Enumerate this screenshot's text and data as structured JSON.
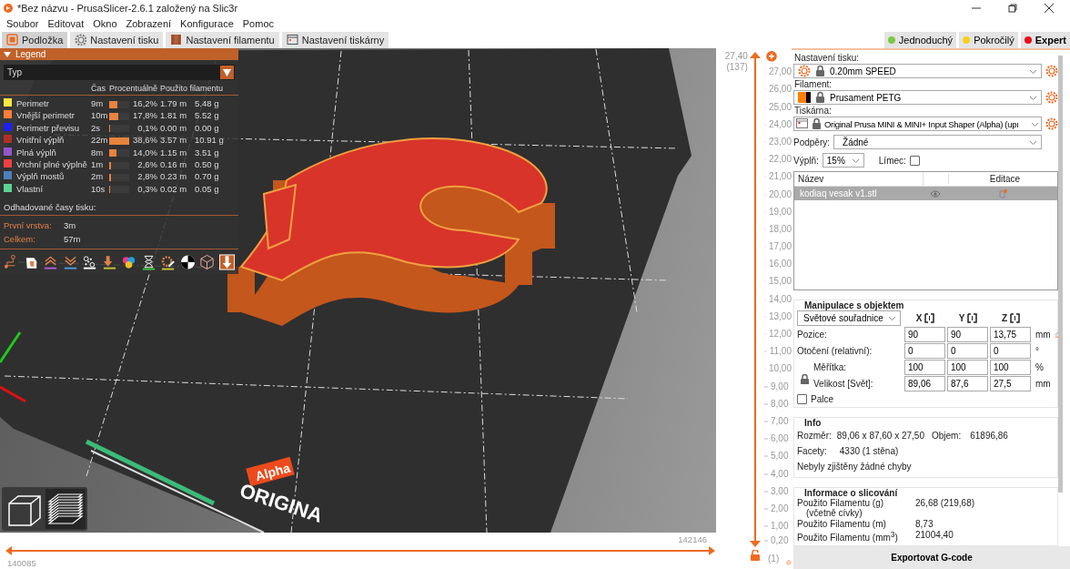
{
  "window": {
    "title": "*Bez názvu - PrusaSlicer-2.6.1 založený na Slic3r"
  },
  "menu": [
    "Soubor",
    "Editovat",
    "Okno",
    "Zobrazení",
    "Konfigurace",
    "Pomoc"
  ],
  "tabs": [
    {
      "label": "Podložka",
      "kind": "plater",
      "selected": true
    },
    {
      "label": "Nastavení tisku",
      "kind": "print",
      "selected": false
    },
    {
      "label": "Nastavení filamentu",
      "kind": "filament",
      "selected": false
    },
    {
      "label": "Nastavení tiskárny",
      "kind": "printer",
      "selected": false
    }
  ],
  "modes": [
    {
      "label": "Jednoduchý",
      "color": "#7ac943",
      "selected": false
    },
    {
      "label": "Pokročilý",
      "color": "#f2d21c",
      "selected": false
    },
    {
      "label": "Expert",
      "color": "#e8101a",
      "selected": true
    }
  ],
  "legend": {
    "title": "Legend",
    "expanded": true,
    "view_type": "Typ",
    "columns": [
      "Čas",
      "Procentuálně",
      "Použito filamentu"
    ],
    "rows": [
      {
        "name": "Perimetr",
        "color": "#ffe640",
        "time": "9m",
        "level": 0.42,
        "percent": "16,2%",
        "length": "1.79 m",
        "weight": "5.48 g"
      },
      {
        "name": "Vnější perimetr",
        "color": "#ff7d38",
        "time": "10m",
        "level": 0.46,
        "percent": "17,8%",
        "length": "1.81 m",
        "weight": "5.52 g"
      },
      {
        "name": "Perimetr převisu",
        "color": "#1f1fff",
        "time": "2s",
        "level": 0.01,
        "percent": "0,1%",
        "length": "0.00 m",
        "weight": "0.00 g"
      },
      {
        "name": "Vnitřní výplň",
        "color": "#b03029",
        "time": "22m",
        "level": 1,
        "percent": "38,6%",
        "length": "3.57 m",
        "weight": "10.91 g"
      },
      {
        "name": "Plná výplň",
        "color": "#9654cc",
        "time": "8m",
        "level": 0.36,
        "percent": "14,0%",
        "length": "1.15 m",
        "weight": "3.51 g"
      },
      {
        "name": "Vrchní plné výplně",
        "color": "#f04040",
        "time": "1m",
        "level": 0.07,
        "percent": "2,6%",
        "length": "0.16 m",
        "weight": "0.50 g"
      },
      {
        "name": "Výplň mostů",
        "color": "#4d80ba",
        "time": "2m",
        "level": 0.07,
        "percent": "2,8%",
        "length": "0.23 m",
        "weight": "0.70 g"
      },
      {
        "name": "Vlastní",
        "color": "#5ed194",
        "time": "10s",
        "level": 0.01,
        "percent": "0,3%",
        "length": "0.02 m",
        "weight": "0.05 g"
      }
    ],
    "estimates_title": "Odhadované časy tisku:",
    "estimates": [
      {
        "label": "První vrstva:",
        "value": "3m"
      },
      {
        "label": "Celkem:",
        "value": "57m"
      }
    ]
  },
  "bed_marks": [
    "Alpha",
    "ORIGINA"
  ],
  "view_buttons": [
    {
      "kind": "cube",
      "selected": false
    },
    {
      "kind": "layers",
      "selected": true
    }
  ],
  "layer_slider": {
    "top_value": "27,40",
    "top_layer": "(137)",
    "ticks": [
      "27,00",
      "26,00",
      "25,00",
      "24,00",
      "23,00",
      "22,00",
      "21,00",
      "20,00",
      "19,00",
      "18,00",
      "17,00",
      "16,00",
      "15,00",
      "14,00",
      "13,00",
      "12,00",
      "11,00",
      "10,00",
      "9,00",
      "8,00",
      "7,00",
      "6,00",
      "5,00",
      "4,00",
      "3,00",
      "2,00",
      "1,00",
      "0,20"
    ],
    "bottom_layer": "(1)"
  },
  "move_slider": {
    "right_value": "142146",
    "left_value": "140085"
  },
  "presets": [
    {
      "label": "Nastavení tisku:",
      "value": "0.20mm SPEED",
      "kind": "print"
    },
    {
      "label": "Filament:",
      "value": "Prusament PETG",
      "kind": "filament"
    },
    {
      "label": "Tiskárna:",
      "value": "Original Prusa MINI & MINI+ Input Shaper (Alpha) (upı",
      "kind": "printer"
    }
  ],
  "supports": {
    "label": "Podpěry:",
    "value": "Žádné"
  },
  "infill": {
    "label": "Výplň:",
    "value": "15%"
  },
  "brim": {
    "label": "Límec:",
    "checked": false
  },
  "objects": {
    "columns": [
      "Název",
      "Editace"
    ],
    "rows": [
      {
        "name": "kodiaq vesak v1.stl",
        "selected": true
      }
    ]
  },
  "manipulation": {
    "title": "Manipulace s objektem",
    "coordinates": "Světové souřadnice",
    "axes": [
      "X",
      "Y",
      "Z"
    ],
    "rows": [
      {
        "label": "Pozice:",
        "values": [
          "90",
          "90",
          "13,75"
        ],
        "unit": "mm"
      },
      {
        "label": "Otočení (relativní):",
        "values": [
          "0",
          "0",
          "0"
        ],
        "unit": "°"
      },
      {
        "label": "Měřítka:",
        "values": [
          "100",
          "100",
          "100"
        ],
        "unit": "%"
      },
      {
        "label": "Velikost [Svět]:",
        "values": [
          "89,06",
          "87,6",
          "27,5"
        ],
        "unit": "mm"
      }
    ],
    "inches": {
      "label": "Palce",
      "checked": false
    }
  },
  "info": {
    "title": "Info",
    "size_label": "Rozměr:",
    "size": "89,06 x 87,60 x 27,50",
    "volume_label": "Objem:",
    "volume": "61896,86",
    "facets_label": "Facety:",
    "facets": "4330 (1 stěna)",
    "status": "Nebyly zjištěny žádné chyby"
  },
  "slicing_info": {
    "title": "Informace o slicování",
    "rows": [
      {
        "label": "Použito Filamentu (g)",
        "sublabel": "(včetně cívky)",
        "value": "26,68 (219,68)"
      },
      {
        "label": "Použito Filamentu (m)",
        "value": "8,73"
      },
      {
        "label": "Použito Filamentu (mm$^{3}$)",
        "value": "21004,40"
      }
    ]
  },
  "export_button": "Exportovat G-code"
}
